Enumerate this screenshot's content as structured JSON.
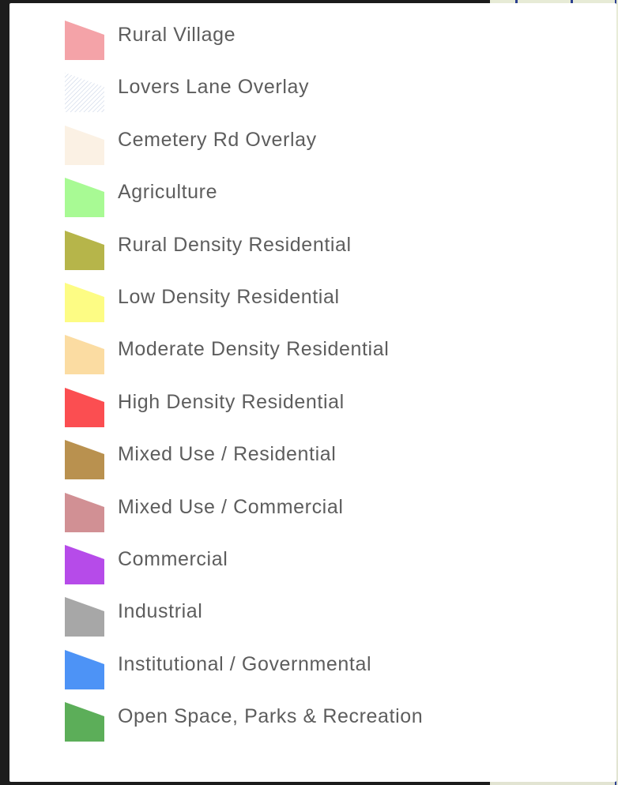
{
  "legend": {
    "items": [
      {
        "label": "Rural Village",
        "color": "#f4a3a8",
        "icon": "polygon-swatch-icon"
      },
      {
        "label": "Lovers Lane Overlay",
        "color": "#e6ecf5",
        "icon": "hatched-swatch-icon"
      },
      {
        "label": "Cemetery Rd Overlay",
        "color": "#fbf1e4",
        "icon": "polygon-swatch-icon"
      },
      {
        "label": "Agriculture",
        "color": "#a8fa94",
        "icon": "polygon-swatch-icon"
      },
      {
        "label": "Rural Density Residential",
        "color": "#b6b54a",
        "icon": "polygon-swatch-icon"
      },
      {
        "label": "Low Density Residential",
        "color": "#fdfc84",
        "icon": "polygon-swatch-icon"
      },
      {
        "label": "Moderate Density Residential",
        "color": "#fbdca2",
        "icon": "polygon-swatch-icon"
      },
      {
        "label": "High Density Residential",
        "color": "#fb4e51",
        "icon": "polygon-swatch-icon"
      },
      {
        "label": "Mixed Use / Residential",
        "color": "#b9914f",
        "icon": "polygon-swatch-icon"
      },
      {
        "label": "Mixed Use / Commercial",
        "color": "#d19094",
        "icon": "polygon-swatch-icon"
      },
      {
        "label": "Commercial",
        "color": "#b64be9",
        "icon": "polygon-swatch-icon"
      },
      {
        "label": "Industrial",
        "color": "#a7a7a7",
        "icon": "polygon-swatch-icon"
      },
      {
        "label": "Institutional / Governmental",
        "color": "#4d93f6",
        "icon": "polygon-swatch-icon"
      },
      {
        "label": "Open Space, Parks & Recreation",
        "color": "#5cae59",
        "icon": "polygon-swatch-icon"
      }
    ]
  }
}
